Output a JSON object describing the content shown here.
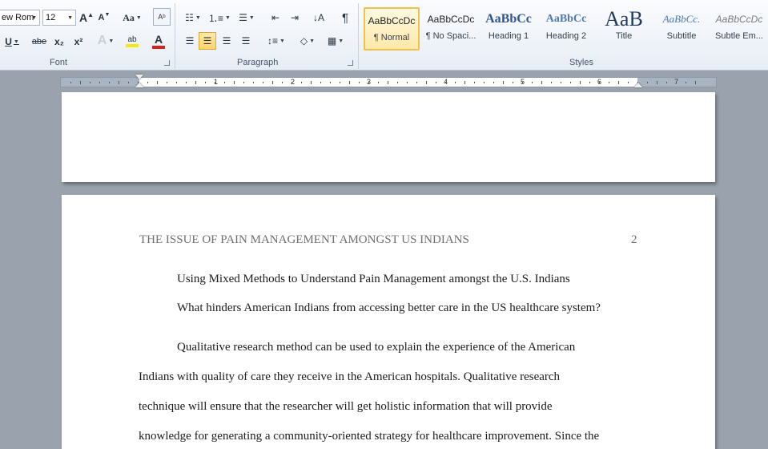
{
  "ribbon": {
    "font": {
      "font_name": "ew Rom",
      "font_size": "12",
      "grow_label": "A",
      "shrink_label": "A",
      "case_label": "Aa",
      "bold_label": "U",
      "strike_label": "abe",
      "sub_label": "x₂",
      "sup_label": "x²",
      "effects_label": "A",
      "highlight_label": "ab",
      "color_label": "A",
      "group_label": "Font"
    },
    "paragraph": {
      "group_label": "Paragraph",
      "pilcrow": "¶"
    },
    "styles": {
      "group_label": "Styles",
      "items": [
        {
          "preview": "AaBbCcDc",
          "name": "¶ Normal"
        },
        {
          "preview": "AaBbCcDc",
          "name": "¶ No Spaci..."
        },
        {
          "preview": "AaBbCc",
          "name": "Heading 1"
        },
        {
          "preview": "AaBbCc",
          "name": "Heading 2"
        },
        {
          "preview": "AaB",
          "name": "Title"
        },
        {
          "preview": "AaBbCc.",
          "name": "Subtitle"
        },
        {
          "preview": "AaBbCcDc",
          "name": "Subtle Em..."
        }
      ]
    },
    "colors": {
      "highlight": "#f5e90e",
      "font_color": "#d2231f",
      "heading": "#2f5496"
    }
  },
  "ruler": {
    "numbers": [
      "1",
      "2",
      "3",
      "4",
      "5",
      "6",
      "7"
    ]
  },
  "document": {
    "running_head": "THE ISSUE OF PAIN MANAGEMENT AMONGST US INDIANS",
    "page_number": "2",
    "title_line": "Using Mixed Methods to Understand Pain Management amongst the U.S. Indians",
    "question_line": "What hinders American Indians from accessing better care in the US healthcare system?",
    "body_lines": [
      "Qualitative research method can be used to explain the experience  of the American",
      "Indians with quality of care they receive in the American hospitals. Qualitative research",
      "technique will ensure that the researcher  will get holistic information that will provide",
      "knowledge for generating a  community-oriented strategy for healthcare improvement.  Since the"
    ]
  }
}
